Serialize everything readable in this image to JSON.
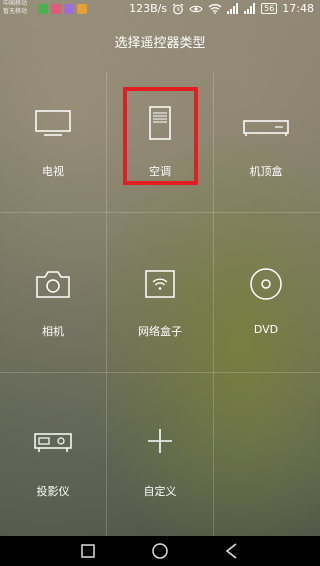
{
  "status_bar": {
    "carrier_line1": "中国移动",
    "carrier_line2": "暂无移动",
    "speed": "123B/s",
    "battery": "56",
    "time": "17:48",
    "app_colors": [
      "#4caf50",
      "#e05a7a",
      "#9c6fd6",
      "#e8a030"
    ]
  },
  "page": {
    "title": "选择遥控器类型"
  },
  "devices": [
    {
      "label": "电视",
      "icon": "tv-icon"
    },
    {
      "label": "空调",
      "icon": "air-conditioner-icon",
      "selected": true
    },
    {
      "label": "机顶盒",
      "icon": "set-top-box-icon"
    },
    {
      "label": "相机",
      "icon": "camera-icon"
    },
    {
      "label": "网络盒子",
      "icon": "network-box-icon"
    },
    {
      "label": "DVD",
      "icon": "dvd-disc-icon"
    },
    {
      "label": "投影仪",
      "icon": "projector-icon"
    },
    {
      "label": "自定义",
      "icon": "plus-icon"
    }
  ],
  "highlight_color": "#e02020"
}
